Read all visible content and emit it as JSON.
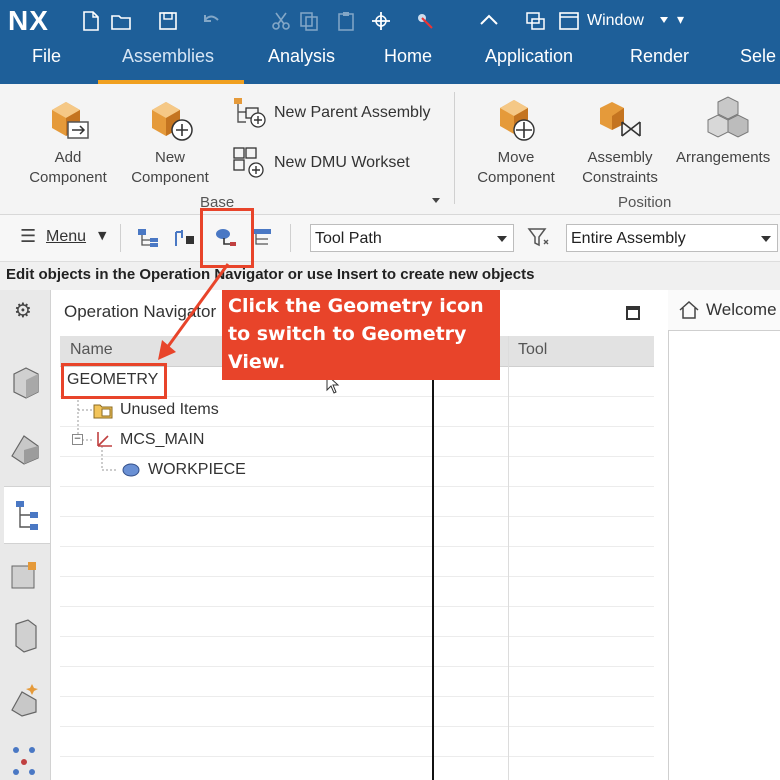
{
  "app": {
    "logo": "NX",
    "window_menu": "Window"
  },
  "tabs": [
    "File",
    "Assemblies",
    "Analysis",
    "Home",
    "Application",
    "Render",
    "Sele"
  ],
  "active_tab": "Assemblies",
  "ribbon": {
    "add_component": {
      "line1": "Add",
      "line2": "Component"
    },
    "new_component": {
      "line1": "New",
      "line2": "Component"
    },
    "new_parent_assembly": "New Parent Assembly",
    "new_dmu_workset": "New DMU Workset",
    "base_group": "Base",
    "move_component": {
      "line1": "Move",
      "line2": "Component"
    },
    "assembly_constraints": {
      "line1": "Assembly",
      "line2": "Constraints"
    },
    "arrangements": "Arrangements",
    "position_group": "Position"
  },
  "toolbar": {
    "menu_label": "Menu",
    "type_filter": "Tool Path",
    "scope_filter": "Entire Assembly"
  },
  "status_line": "Edit objects in the Operation Navigator or use Insert to create new objects",
  "navigator": {
    "title": "Operation Navigator",
    "columns": {
      "name": "Name",
      "tool": "Tool"
    },
    "rows": [
      {
        "label": "GEOMETRY"
      },
      {
        "label": "Unused Items"
      },
      {
        "label": "MCS_MAIN"
      },
      {
        "label": "WORKPIECE"
      }
    ]
  },
  "welcome_tab": "Welcome",
  "annotation": {
    "callout_text": "Click the Geometry icon to switch to Geometry View."
  },
  "colors": {
    "titlebar": "#1e5f99",
    "accent": "#f0a020",
    "annotation": "#e8442a"
  }
}
